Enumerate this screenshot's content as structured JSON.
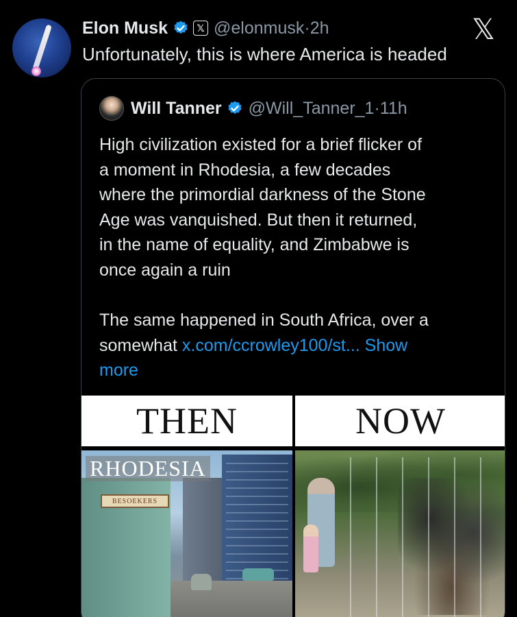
{
  "tweet": {
    "author_name": "Elon Musk",
    "author_handle": "@elonmusk",
    "time": "2h",
    "text": "Unfortunately, this is where America is headed",
    "brand_logo": "X"
  },
  "quoted_tweet": {
    "author_name": "Will Tanner",
    "author_handle": "@Will_Tanner_1",
    "time": "11h",
    "lines": [
      "High civilization existed for a brief flicker of",
      "a moment in Rhodesia, a few decades",
      "where the primordial darkness of the Stone",
      "Age was vanquished. But then it returned,",
      "in the name of equality, and Zimbabwe is",
      "once again a ruin",
      "",
      "The same happened in South Africa, over a"
    ],
    "last_line_prefix": "somewhat ",
    "link_text": "x.com/ccrowley100/st...",
    "show_more_part1": " Show",
    "show_more_part2": "more"
  },
  "media": {
    "left_label": "THEN",
    "right_label": "NOW",
    "left_caption": "RHODESIA",
    "sign_text": "BESOEKERS"
  },
  "colors": {
    "background": "#000000",
    "text": "#e7e9ea",
    "secondary": "#8b98a5",
    "link": "#1d9bf0",
    "verified": "#1d9bf0"
  },
  "icons": {
    "verified": "verified-badge-icon",
    "affiliate": "x-affiliate-icon",
    "logo": "x-logo-icon"
  }
}
